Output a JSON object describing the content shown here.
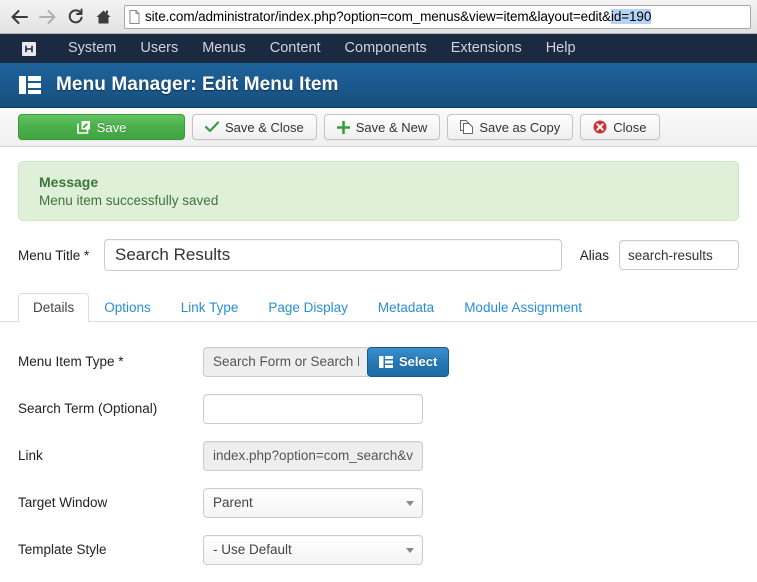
{
  "browser": {
    "back_icon": "back-arrow-icon",
    "forward_icon": "forward-arrow-icon",
    "reload_icon": "reload-icon",
    "home_icon": "home-icon",
    "page_icon": "page-icon",
    "url_prefix": "site.com/administrator/index.php?option=com_menus&view=item&layout=edit&",
    "url_selected": "id=190",
    "url_full": "site.com/administrator/index.php?option=com_menus&view=item&layout=edit&id=190",
    "selection_color": "#b5d3f5"
  },
  "admin_menu": {
    "logo_icon": "joomla-logo-icon",
    "items": [
      {
        "label": "System"
      },
      {
        "label": "Users"
      },
      {
        "label": "Menus"
      },
      {
        "label": "Content"
      },
      {
        "label": "Components"
      },
      {
        "label": "Extensions"
      },
      {
        "label": "Help"
      }
    ],
    "bg_color": "#1b2a41"
  },
  "header": {
    "icon": "menu-grid-icon",
    "title": "Menu Manager: Edit Menu Item",
    "bg_color": "#1a5789"
  },
  "toolbar": {
    "save_label": "Save",
    "save_icon": "pencil-square-icon",
    "save_color": "#4aaf4a",
    "save_close_label": "Save & Close",
    "save_close_icon": "check-icon",
    "save_new_label": "Save & New",
    "save_new_icon": "plus-icon",
    "save_copy_label": "Save as Copy",
    "save_copy_icon": "copy-icon",
    "close_label": "Close",
    "close_icon": "close-circle-icon"
  },
  "message": {
    "title": "Message",
    "text": "Menu item successfully saved",
    "bg_color": "#dff0d8",
    "text_color": "#3c763d"
  },
  "title_row": {
    "menu_title_label": "Menu Title *",
    "menu_title_value": "Search Results",
    "alias_label": "Alias",
    "alias_value": "search-results"
  },
  "tabs": [
    {
      "label": "Details",
      "active": true
    },
    {
      "label": "Options",
      "active": false
    },
    {
      "label": "Link Type",
      "active": false
    },
    {
      "label": "Page Display",
      "active": false
    },
    {
      "label": "Metadata",
      "active": false
    },
    {
      "label": "Module Assignment",
      "active": false
    }
  ],
  "form": {
    "menu_item_type_label": "Menu Item Type *",
    "menu_item_type_value": "Search Form or Search Results",
    "select_button_label": "Select",
    "select_button_icon": "list-grid-icon",
    "search_term_label": "Search Term (Optional)",
    "search_term_value": "",
    "link_label": "Link",
    "link_value": "index.php?option=com_search&view=search",
    "target_window_label": "Target Window",
    "target_window_value": "Parent",
    "template_style_label": "Template Style",
    "template_style_value": "- Use Default",
    "dropdown_icon": "chevron-down-icon"
  }
}
